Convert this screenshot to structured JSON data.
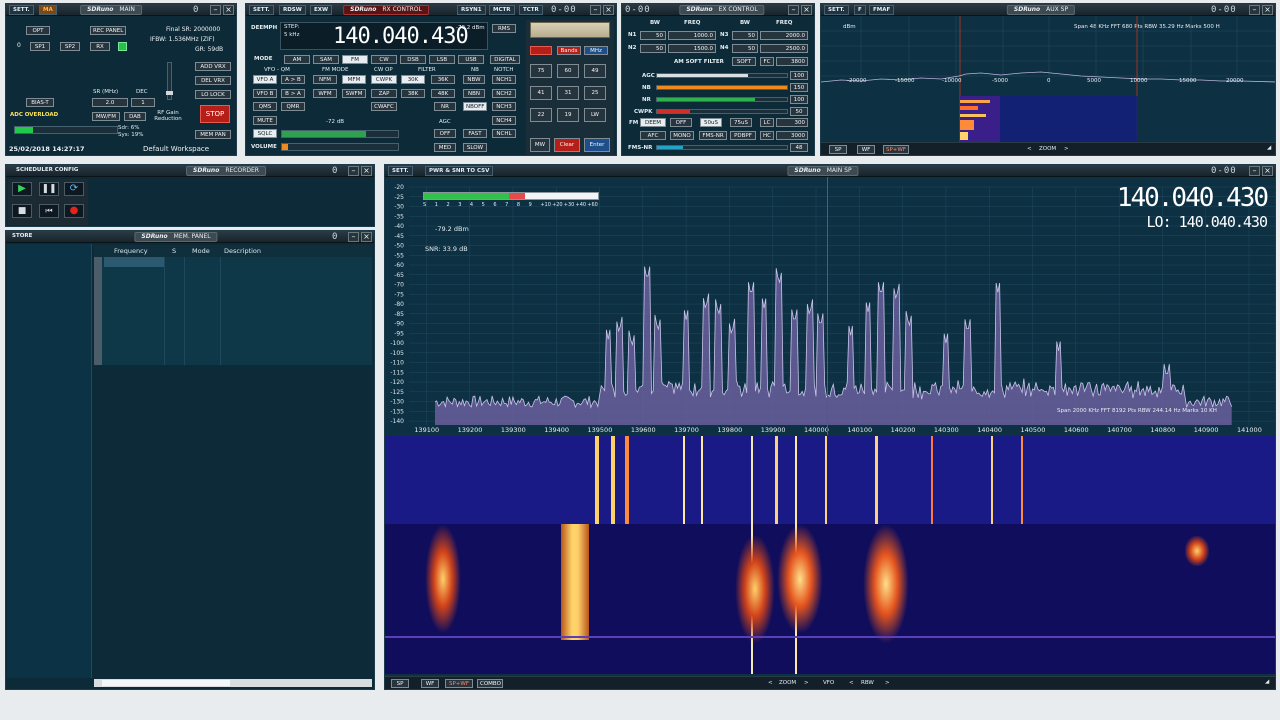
{
  "main": {
    "title_logo": "SDRuno",
    "title": "MAIN",
    "sett": "SETT.",
    "ma": "MA",
    "buttons": {
      "opt": "OPT",
      "rec_panel": "REC PANEL",
      "sp1": "SP1",
      "sp2": "SP2",
      "rx": "RX",
      "add_vrx": "ADD VRX",
      "del_vrx": "DEL VRX",
      "lo_lock": "LO LOCK",
      "bias_t": "BIAS-T",
      "mw_fm": "MW/FM",
      "dab": "DAB",
      "stop": "STOP",
      "mem_pan": "MEM PAN"
    },
    "rx_index": "0",
    "final_sr": "Final SR: 2000000",
    "ifbw": "IFBW: 1.536MHz (ZIF)",
    "gr": "GR: 59dB",
    "sr_label": "SR (MHz)",
    "sr_value": "2.0",
    "dec_label": "DEC",
    "dec_value": "1",
    "rf_gain": "RF Gain Reduction",
    "adc_overload": "ADC OVERLOAD",
    "sdr_pct": "Sdr: 6%",
    "sys_pct": "Sys: 19%",
    "datetime": "25/02/2018 14:27:17",
    "workspace": "Default Workspace"
  },
  "rx_control": {
    "title_logo": "SDRuno",
    "title": "RX CONTROL",
    "tabs": [
      "SETT.",
      "RDSW",
      "EXW",
      "RSYN1",
      "MCTR",
      "TCTR"
    ],
    "deemph": "DEEMPH",
    "step": "STEP:",
    "step_val": "5 kHz",
    "frequency": "140.040.430",
    "dbm": "-79.2 dBm",
    "rms": "RMS",
    "mode_label": "MODE",
    "modes": [
      "AM",
      "SAM",
      "FM",
      "CW",
      "DSB",
      "LSB",
      "USB",
      "DIGITAL"
    ],
    "vfo_label": "VFO - QM",
    "vfo_buttons": [
      "VFO A",
      "A > B",
      "VFO B",
      "B > A",
      "QMS",
      "QMR"
    ],
    "fm_mode_label": "FM MODE",
    "fm_modes": [
      "NFM",
      "MFM",
      "WFM",
      "SWFM"
    ],
    "cw_op_label": "CW OP",
    "cw_op": [
      "CWPK",
      "ZAP",
      "CWAFC"
    ],
    "filter_label": "FILTER",
    "filters": [
      "30K",
      "36K",
      "38K",
      "48K"
    ],
    "nb_label": "NB",
    "nb": [
      "NBW",
      "NBN",
      "NR"
    ],
    "notch_label": "NOTCH",
    "notch": [
      "NCH1",
      "NCH2",
      "NCH3",
      "NCH4",
      "NCHL"
    ],
    "nboff": "NBOFF",
    "mute": "MUTE",
    "sqlc": "SQLC",
    "squelch_db": "-72 dB",
    "agc_label": "AGC",
    "agc": [
      "OFF",
      "FAST",
      "MED",
      "SLOW"
    ],
    "volume": "VOLUME",
    "keypad_labels": [
      "Bands",
      "MHz",
      "MW",
      "Clear",
      "Enter",
      "LW"
    ],
    "keypad_numbers": [
      "75",
      "60",
      "49",
      "41",
      "31",
      "25",
      "22",
      "19"
    ],
    "digital_time": "0-00"
  },
  "ex_control": {
    "title_logo": "SDRuno",
    "title": "EX CONTROL",
    "col_bw": "BW",
    "col_freq": "FREQ",
    "rows": [
      {
        "n": "N1",
        "bw": "50",
        "freq": "1000.0",
        "n2": "N3",
        "bw2": "50",
        "freq2": "2000.0"
      },
      {
        "n": "N2",
        "bw": "50",
        "freq": "1500.0",
        "n2": "N4",
        "bw2": "50",
        "freq2": "2500.0"
      }
    ],
    "am_soft_filter": "AM SOFT FILTER",
    "soft": "SOFT",
    "fc": "FC",
    "fc_value": "3800",
    "sliders": [
      {
        "label": "AGC",
        "value": "100"
      },
      {
        "label": "NB",
        "value": "150"
      },
      {
        "label": "NR",
        "value": "100"
      },
      {
        "label": "CWPK",
        "value": "50"
      }
    ],
    "fm_label": "FM",
    "deem": "DEEM",
    "off": "OFF",
    "us50": "50uS",
    "us75": "75uS",
    "lc": "LC",
    "lc_value": "300",
    "afc": "AFC",
    "mono": "MONO",
    "fms_nr_btn": "FMS-NR",
    "pdbpf": "PDBPF",
    "hc": "HC",
    "hc_value": "3000",
    "fms_nr": "FMS-NR",
    "fms_nr_value": "48",
    "digital_time": "0-00"
  },
  "aux_sp": {
    "title_logo": "SDRuno",
    "title": "AUX SP",
    "sett": "SETT.",
    "f": "F",
    "fmaf": "FMAF",
    "info": "Span 48 KHz  FFT 680 Pts  RBW 35.29 Hz  Marks 500 H",
    "unit": "dBm",
    "x_ticks": [
      "-20000",
      "-15000",
      "-10000",
      "-5000",
      "0",
      "5000",
      "10000",
      "15000",
      "20000"
    ],
    "bottom": [
      "SP",
      "WF",
      "SP+WF"
    ],
    "zoom": "ZOOM",
    "digital_time": "0-00"
  },
  "scheduler": {
    "title": "SCHEDULER CONFIG",
    "recorder_logo": "SDRuno",
    "recorder": "RECORDER"
  },
  "mem_panel": {
    "title_logo": "SDRuno",
    "title": "MEM. PANEL",
    "store": "STORE",
    "columns": [
      "Frequency",
      "S",
      "Mode",
      "Description"
    ]
  },
  "main_sp": {
    "title_logo": "SDRuno",
    "title": "MAIN SP",
    "sett": "SETT.",
    "pwr_snr": "PWR & SNR TO CSV",
    "frequency": "140.040.430",
    "lo": "LO: 140.040.430",
    "dbm_readout": "-79.2 dBm",
    "snr_readout": "SNR: 33.9 dB",
    "smeter_scale": [
      "S",
      "1",
      "2",
      "3",
      "4",
      "5",
      "6",
      "7",
      "8",
      "9",
      "+10",
      "+20",
      "+30",
      "+40",
      "+60"
    ],
    "info": "Span 2000 KHz  FFT 8192 Pts  RBW 244.14 Hz  Marks 10 KH",
    "y_ticks": [
      "-20",
      "-25",
      "-30",
      "-35",
      "-40",
      "-45",
      "-50",
      "-55",
      "-60",
      "-65",
      "-70",
      "-75",
      "-80",
      "-85",
      "-90",
      "-95",
      "-100",
      "-105",
      "-110",
      "-115",
      "-120",
      "-125",
      "-130",
      "-135",
      "-140"
    ],
    "x_ticks": [
      "139100",
      "139200",
      "139300",
      "139400",
      "139500",
      "139600",
      "139700",
      "139800",
      "139900",
      "140000",
      "140100",
      "140200",
      "140300",
      "140400",
      "140500",
      "140600",
      "140700",
      "140800",
      "140900",
      "141000"
    ],
    "bottom": [
      "SP",
      "WF",
      "SP+WF",
      "COMBO"
    ],
    "zoom": "ZOOM",
    "vfo": "VFO",
    "rbw": "RBW",
    "digital_time": "0-00",
    "peaks": [
      {
        "x": 139520,
        "db": -98
      },
      {
        "x": 139545,
        "db": -95
      },
      {
        "x": 139575,
        "db": -102
      },
      {
        "x": 139610,
        "db": -68
      },
      {
        "x": 139635,
        "db": -94
      },
      {
        "x": 139700,
        "db": -88
      },
      {
        "x": 139745,
        "db": -83
      },
      {
        "x": 139775,
        "db": -86
      },
      {
        "x": 139805,
        "db": -96
      },
      {
        "x": 139850,
        "db": -76
      },
      {
        "x": 139880,
        "db": -82
      },
      {
        "x": 139915,
        "db": -70
      },
      {
        "x": 139950,
        "db": -90
      },
      {
        "x": 139985,
        "db": -86
      },
      {
        "x": 140010,
        "db": -92
      },
      {
        "x": 140080,
        "db": -96
      },
      {
        "x": 140120,
        "db": -84
      },
      {
        "x": 140150,
        "db": -76
      },
      {
        "x": 140185,
        "db": -78
      },
      {
        "x": 140215,
        "db": -92
      },
      {
        "x": 140300,
        "db": -100
      },
      {
        "x": 140350,
        "db": -95
      },
      {
        "x": 140420,
        "db": -74
      },
      {
        "x": 140560,
        "db": -104
      },
      {
        "x": 140810,
        "db": -118
      }
    ]
  },
  "colors": {
    "panel": "#0c2a38",
    "spectrum": "#0d3043",
    "trace": "#c9c5e8",
    "fill": "#6a5f9e",
    "marker": "#ff3b1f",
    "accent_green": "#22c84a",
    "accent_orange": "#f08a1c"
  }
}
